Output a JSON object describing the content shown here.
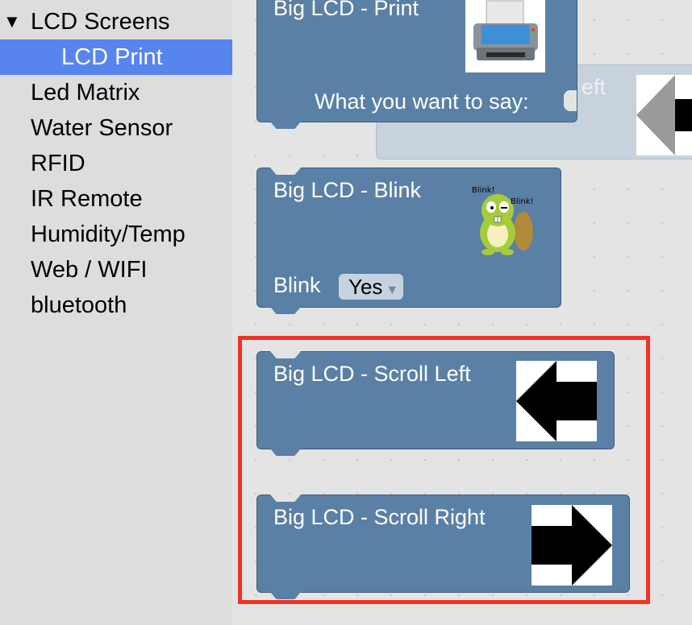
{
  "sidebar": {
    "items": [
      {
        "label": "LCD Screens",
        "caret": "▼"
      },
      {
        "label": "LCD Print"
      },
      {
        "label": "Led Matrix"
      },
      {
        "label": "Water Sensor"
      },
      {
        "label": "RFID"
      },
      {
        "label": "IR Remote"
      },
      {
        "label": "Humidity/Temp"
      },
      {
        "label": "Web / WIFI"
      },
      {
        "label": "bluetooth"
      }
    ],
    "selected_color": "#5785ee"
  },
  "workspace": {
    "ghost_block": {
      "partial_label": "eft"
    },
    "print_block": {
      "title": "Big LCD - Print",
      "input_label": "What you want to say:",
      "icon": "printer-icon"
    },
    "blink_block": {
      "title": "Big LCD - Blink",
      "field_label": "Blink",
      "dropdown_value": "Yes",
      "icon": "beaver-icon",
      "icon_text_1": "Blink!",
      "icon_text_2": "Blink!"
    },
    "scroll_left_block": {
      "title": "Big LCD - Scroll Left",
      "icon": "arrow-left-icon"
    },
    "scroll_right_block": {
      "title": "Big LCD - Scroll Right",
      "icon": "arrow-right-icon"
    },
    "block_color": "#5b80a5",
    "highlight_color": "#ef3324"
  }
}
